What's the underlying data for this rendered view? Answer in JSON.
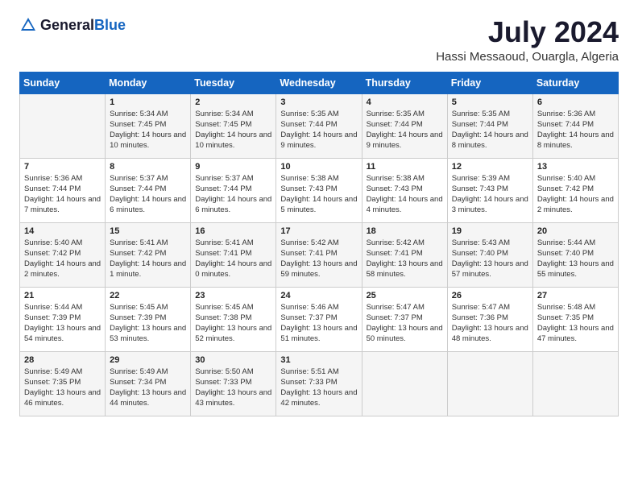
{
  "logo": {
    "text_general": "General",
    "text_blue": "Blue"
  },
  "title": "July 2024",
  "location": "Hassi Messaoud, Ouargla, Algeria",
  "days_of_week": [
    "Sunday",
    "Monday",
    "Tuesday",
    "Wednesday",
    "Thursday",
    "Friday",
    "Saturday"
  ],
  "weeks": [
    [
      {
        "day": "",
        "sunrise": "",
        "sunset": "",
        "daylight": ""
      },
      {
        "day": "1",
        "sunrise": "Sunrise: 5:34 AM",
        "sunset": "Sunset: 7:45 PM",
        "daylight": "Daylight: 14 hours and 10 minutes."
      },
      {
        "day": "2",
        "sunrise": "Sunrise: 5:34 AM",
        "sunset": "Sunset: 7:45 PM",
        "daylight": "Daylight: 14 hours and 10 minutes."
      },
      {
        "day": "3",
        "sunrise": "Sunrise: 5:35 AM",
        "sunset": "Sunset: 7:44 PM",
        "daylight": "Daylight: 14 hours and 9 minutes."
      },
      {
        "day": "4",
        "sunrise": "Sunrise: 5:35 AM",
        "sunset": "Sunset: 7:44 PM",
        "daylight": "Daylight: 14 hours and 9 minutes."
      },
      {
        "day": "5",
        "sunrise": "Sunrise: 5:35 AM",
        "sunset": "Sunset: 7:44 PM",
        "daylight": "Daylight: 14 hours and 8 minutes."
      },
      {
        "day": "6",
        "sunrise": "Sunrise: 5:36 AM",
        "sunset": "Sunset: 7:44 PM",
        "daylight": "Daylight: 14 hours and 8 minutes."
      }
    ],
    [
      {
        "day": "7",
        "sunrise": "Sunrise: 5:36 AM",
        "sunset": "Sunset: 7:44 PM",
        "daylight": "Daylight: 14 hours and 7 minutes."
      },
      {
        "day": "8",
        "sunrise": "Sunrise: 5:37 AM",
        "sunset": "Sunset: 7:44 PM",
        "daylight": "Daylight: 14 hours and 6 minutes."
      },
      {
        "day": "9",
        "sunrise": "Sunrise: 5:37 AM",
        "sunset": "Sunset: 7:44 PM",
        "daylight": "Daylight: 14 hours and 6 minutes."
      },
      {
        "day": "10",
        "sunrise": "Sunrise: 5:38 AM",
        "sunset": "Sunset: 7:43 PM",
        "daylight": "Daylight: 14 hours and 5 minutes."
      },
      {
        "day": "11",
        "sunrise": "Sunrise: 5:38 AM",
        "sunset": "Sunset: 7:43 PM",
        "daylight": "Daylight: 14 hours and 4 minutes."
      },
      {
        "day": "12",
        "sunrise": "Sunrise: 5:39 AM",
        "sunset": "Sunset: 7:43 PM",
        "daylight": "Daylight: 14 hours and 3 minutes."
      },
      {
        "day": "13",
        "sunrise": "Sunrise: 5:40 AM",
        "sunset": "Sunset: 7:42 PM",
        "daylight": "Daylight: 14 hours and 2 minutes."
      }
    ],
    [
      {
        "day": "14",
        "sunrise": "Sunrise: 5:40 AM",
        "sunset": "Sunset: 7:42 PM",
        "daylight": "Daylight: 14 hours and 2 minutes."
      },
      {
        "day": "15",
        "sunrise": "Sunrise: 5:41 AM",
        "sunset": "Sunset: 7:42 PM",
        "daylight": "Daylight: 14 hours and 1 minute."
      },
      {
        "day": "16",
        "sunrise": "Sunrise: 5:41 AM",
        "sunset": "Sunset: 7:41 PM",
        "daylight": "Daylight: 14 hours and 0 minutes."
      },
      {
        "day": "17",
        "sunrise": "Sunrise: 5:42 AM",
        "sunset": "Sunset: 7:41 PM",
        "daylight": "Daylight: 13 hours and 59 minutes."
      },
      {
        "day": "18",
        "sunrise": "Sunrise: 5:42 AM",
        "sunset": "Sunset: 7:41 PM",
        "daylight": "Daylight: 13 hours and 58 minutes."
      },
      {
        "day": "19",
        "sunrise": "Sunrise: 5:43 AM",
        "sunset": "Sunset: 7:40 PM",
        "daylight": "Daylight: 13 hours and 57 minutes."
      },
      {
        "day": "20",
        "sunrise": "Sunrise: 5:44 AM",
        "sunset": "Sunset: 7:40 PM",
        "daylight": "Daylight: 13 hours and 55 minutes."
      }
    ],
    [
      {
        "day": "21",
        "sunrise": "Sunrise: 5:44 AM",
        "sunset": "Sunset: 7:39 PM",
        "daylight": "Daylight: 13 hours and 54 minutes."
      },
      {
        "day": "22",
        "sunrise": "Sunrise: 5:45 AM",
        "sunset": "Sunset: 7:39 PM",
        "daylight": "Daylight: 13 hours and 53 minutes."
      },
      {
        "day": "23",
        "sunrise": "Sunrise: 5:45 AM",
        "sunset": "Sunset: 7:38 PM",
        "daylight": "Daylight: 13 hours and 52 minutes."
      },
      {
        "day": "24",
        "sunrise": "Sunrise: 5:46 AM",
        "sunset": "Sunset: 7:37 PM",
        "daylight": "Daylight: 13 hours and 51 minutes."
      },
      {
        "day": "25",
        "sunrise": "Sunrise: 5:47 AM",
        "sunset": "Sunset: 7:37 PM",
        "daylight": "Daylight: 13 hours and 50 minutes."
      },
      {
        "day": "26",
        "sunrise": "Sunrise: 5:47 AM",
        "sunset": "Sunset: 7:36 PM",
        "daylight": "Daylight: 13 hours and 48 minutes."
      },
      {
        "day": "27",
        "sunrise": "Sunrise: 5:48 AM",
        "sunset": "Sunset: 7:35 PM",
        "daylight": "Daylight: 13 hours and 47 minutes."
      }
    ],
    [
      {
        "day": "28",
        "sunrise": "Sunrise: 5:49 AM",
        "sunset": "Sunset: 7:35 PM",
        "daylight": "Daylight: 13 hours and 46 minutes."
      },
      {
        "day": "29",
        "sunrise": "Sunrise: 5:49 AM",
        "sunset": "Sunset: 7:34 PM",
        "daylight": "Daylight: 13 hours and 44 minutes."
      },
      {
        "day": "30",
        "sunrise": "Sunrise: 5:50 AM",
        "sunset": "Sunset: 7:33 PM",
        "daylight": "Daylight: 13 hours and 43 minutes."
      },
      {
        "day": "31",
        "sunrise": "Sunrise: 5:51 AM",
        "sunset": "Sunset: 7:33 PM",
        "daylight": "Daylight: 13 hours and 42 minutes."
      },
      {
        "day": "",
        "sunrise": "",
        "sunset": "",
        "daylight": ""
      },
      {
        "day": "",
        "sunrise": "",
        "sunset": "",
        "daylight": ""
      },
      {
        "day": "",
        "sunrise": "",
        "sunset": "",
        "daylight": ""
      }
    ]
  ]
}
